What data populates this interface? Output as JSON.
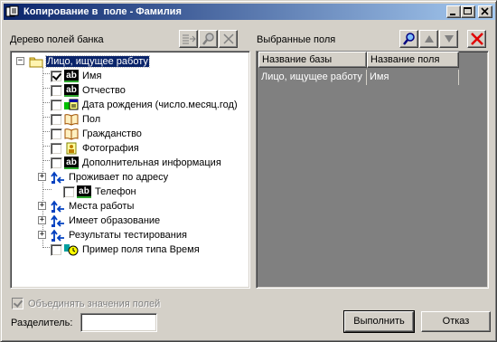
{
  "window": {
    "title": "Копирование в  поле - Фамилия",
    "titlebar_gradient": [
      "#0a246a",
      "#a6caf0"
    ]
  },
  "left_panel": {
    "label": "Дерево полей банка",
    "tools": [
      "add-field-icon",
      "search-icon",
      "delete-icon"
    ]
  },
  "tree": {
    "root": "Лицо, ищущее работу",
    "items": [
      {
        "label": "Имя",
        "icon": "text-field-icon",
        "checked": true
      },
      {
        "label": "Отчество",
        "icon": "text-field-icon",
        "checked": false
      },
      {
        "label": "Дата рождения (число.месяц.год)",
        "icon": "date-field-icon",
        "checked": false
      },
      {
        "label": "Пол",
        "icon": "dictionary-icon",
        "checked": false
      },
      {
        "label": "Гражданство",
        "icon": "dictionary-icon",
        "checked": false
      },
      {
        "label": "Фотография",
        "icon": "image-field-icon",
        "checked": false
      },
      {
        "label": "Дополнительная информация",
        "icon": "text-field-icon",
        "checked": false
      },
      {
        "label": "Проживает по адресу",
        "icon": "link-field-icon",
        "expandable": true
      },
      {
        "label": "Телефон",
        "icon": "text-field-icon",
        "checked": false
      },
      {
        "label": "Места работы",
        "icon": "link-field-icon",
        "expandable": true
      },
      {
        "label": "Имеет образование",
        "icon": "link-field-icon",
        "expandable": true
      },
      {
        "label": "Результаты тестирования",
        "icon": "link-field-icon",
        "expandable": true
      },
      {
        "label": "Пример поля типа Время",
        "icon": "time-field-icon",
        "checked": false
      }
    ]
  },
  "right_panel": {
    "label": "Выбранные поля",
    "tools": [
      "search-icon",
      "move-up-icon",
      "move-down-icon",
      "remove-icon"
    ],
    "columns": [
      "Название базы",
      "Название поля"
    ],
    "rows": [
      [
        "Лицо, ищущее работу",
        "Имя"
      ]
    ]
  },
  "options": {
    "merge_label": "Объединять значения полей",
    "merge_checked": true,
    "separator_label": "Разделитель:",
    "separator_value": ""
  },
  "buttons": {
    "ok": "Выполнить",
    "cancel": "Отказ"
  }
}
